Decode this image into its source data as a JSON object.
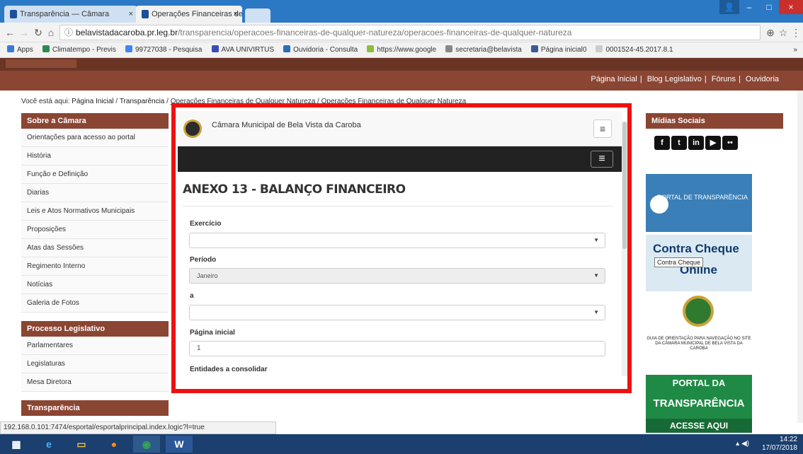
{
  "browser": {
    "tabs": [
      {
        "label": "Transparência — Câmara",
        "close": "×"
      },
      {
        "label": "Operações Financeiras de",
        "close": "×"
      }
    ],
    "window_controls": [
      "–",
      "□",
      "×"
    ],
    "url_host": "belavistadacaroba.pr.leg.br",
    "url_path": "/transparencia/operacoes-financeiras-de-qualquer-natureza/operacoes-financeiras-de-qualquer-natureza",
    "bookmarks": [
      "Apps",
      "Climatempo - Previs",
      "99727038 - Pesquisa",
      "AVA UNIVIRTUS",
      "Ouvidoria - Consulta",
      "https://www.google",
      "secretaria@belavista",
      "Página inicial0",
      "0001524-45.2017.8.1"
    ],
    "bookmarks_more": "»"
  },
  "site": {
    "topnav": [
      "Página Inicial",
      "Blog Legislativo",
      "Fóruns",
      "Ouvidoria"
    ],
    "breadcrumb": {
      "prefix": "Você está aqui:",
      "items": [
        "Página Inicial",
        "Transparência",
        "Operações Financeiras de Qualquer Natureza",
        "Operações Financeiras de Qualquer Natureza"
      ]
    },
    "sidebar": {
      "section1_title": "Sobre a Câmara",
      "section1_items": [
        "Orientações para acesso ao portal",
        "História",
        "Função e Definição",
        "Diarias",
        "Leis e Atos Normativos Municipais",
        "Proposições",
        "Atas das Sessões",
        "Regimento Interno",
        "Notícias",
        "Galeria de Fotos"
      ],
      "section2_title": "Processo Legislativo",
      "section2_items": [
        "Parlamentares",
        "Legislaturas",
        "Mesa Diretora"
      ],
      "section3_title": "Transparência"
    },
    "embed": {
      "org_name": "Câmara Municipal de Bela Vista da Caroba",
      "menu_icon": "≡",
      "title": "ANEXO 13 - BALANÇO FINANCEIRO",
      "fields": {
        "exercicio_label": "Exercício",
        "exercicio_value": "",
        "periodo_label": "Período",
        "periodo_value": "Janeiro",
        "a_label": "a",
        "a_value": "",
        "pagina_label": "Página inicial",
        "pagina_value": "1",
        "entidades_label": "Entidades a consolidar"
      }
    },
    "right": {
      "midias_title": "Mídias Sociais",
      "portal_text": "PORTAL DE TRANSPARÊNCIA",
      "cheque_line1": "Contra Cheque",
      "cheque_line2": "Online",
      "tooltip": "Contra Cheque",
      "guia_text": "GUIA DE ORIENTAÇÃO PARA NAVEGAÇÃO NO SITE DA CÂMARA MUNICIPAL DE BELA VISTA DA CAROBA",
      "transp_a": "PORTAL DA",
      "transp_b": "TRANSPARÊNCIA",
      "transp_c": "ACESSE AQUI"
    }
  },
  "statusbar": "192.168.0.101:7474/esportal/esportalprincipal.index.logic?l=true",
  "taskbar": {
    "time": "14:22",
    "date": "17/07/2018"
  },
  "colors": {
    "accent": "#8b4533",
    "frame": "#ee1111"
  }
}
